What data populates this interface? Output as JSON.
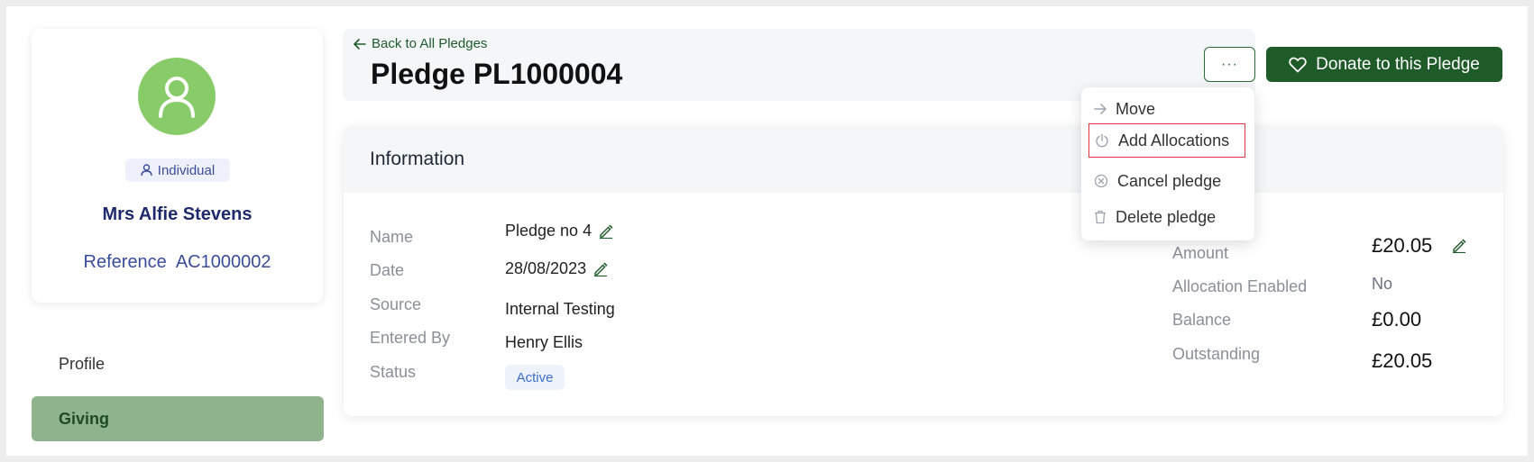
{
  "profile": {
    "badge": "Individual",
    "name": "Mrs Alfie Stevens",
    "reference_label": "Reference",
    "reference_value": "AC1000002"
  },
  "sidebar": {
    "items": [
      {
        "label": "Profile"
      },
      {
        "label": "Giving"
      }
    ]
  },
  "header": {
    "back_link": "Back to All Pledges",
    "title": "Pledge PL1000004",
    "more_label": "···",
    "donate_label": "Donate to this Pledge"
  },
  "dropdown": {
    "items": [
      {
        "label": "Move",
        "icon": "arrow-right-icon"
      },
      {
        "label": "Add Allocations",
        "icon": "power-icon"
      },
      {
        "label": "Cancel pledge",
        "icon": "cancel-circle-icon"
      },
      {
        "label": "Delete pledge",
        "icon": "trash-icon"
      }
    ]
  },
  "info": {
    "title": "Information",
    "left": {
      "name_label": "Name",
      "name_value": "Pledge no 4",
      "date_label": "Date",
      "date_value": "28/08/2023",
      "source_label": "Source",
      "source_value": "Internal Testing",
      "entered_by_label": "Entered By",
      "entered_by_value": "Henry Ellis",
      "status_label": "Status",
      "status_value": "Active"
    },
    "right": {
      "amount_label": "Amount",
      "amount_value": "£20.05",
      "allocation_label": "Allocation Enabled",
      "allocation_value": "No",
      "balance_label": "Balance",
      "balance_value": "£0.00",
      "outstanding_label": "Outstanding",
      "outstanding_value": "£20.05"
    }
  },
  "colors": {
    "brand_green": "#1f5a29",
    "avatar_green": "#88cc6a",
    "giving_active": "#8fb38d",
    "highlight_red": "#e0353c"
  }
}
